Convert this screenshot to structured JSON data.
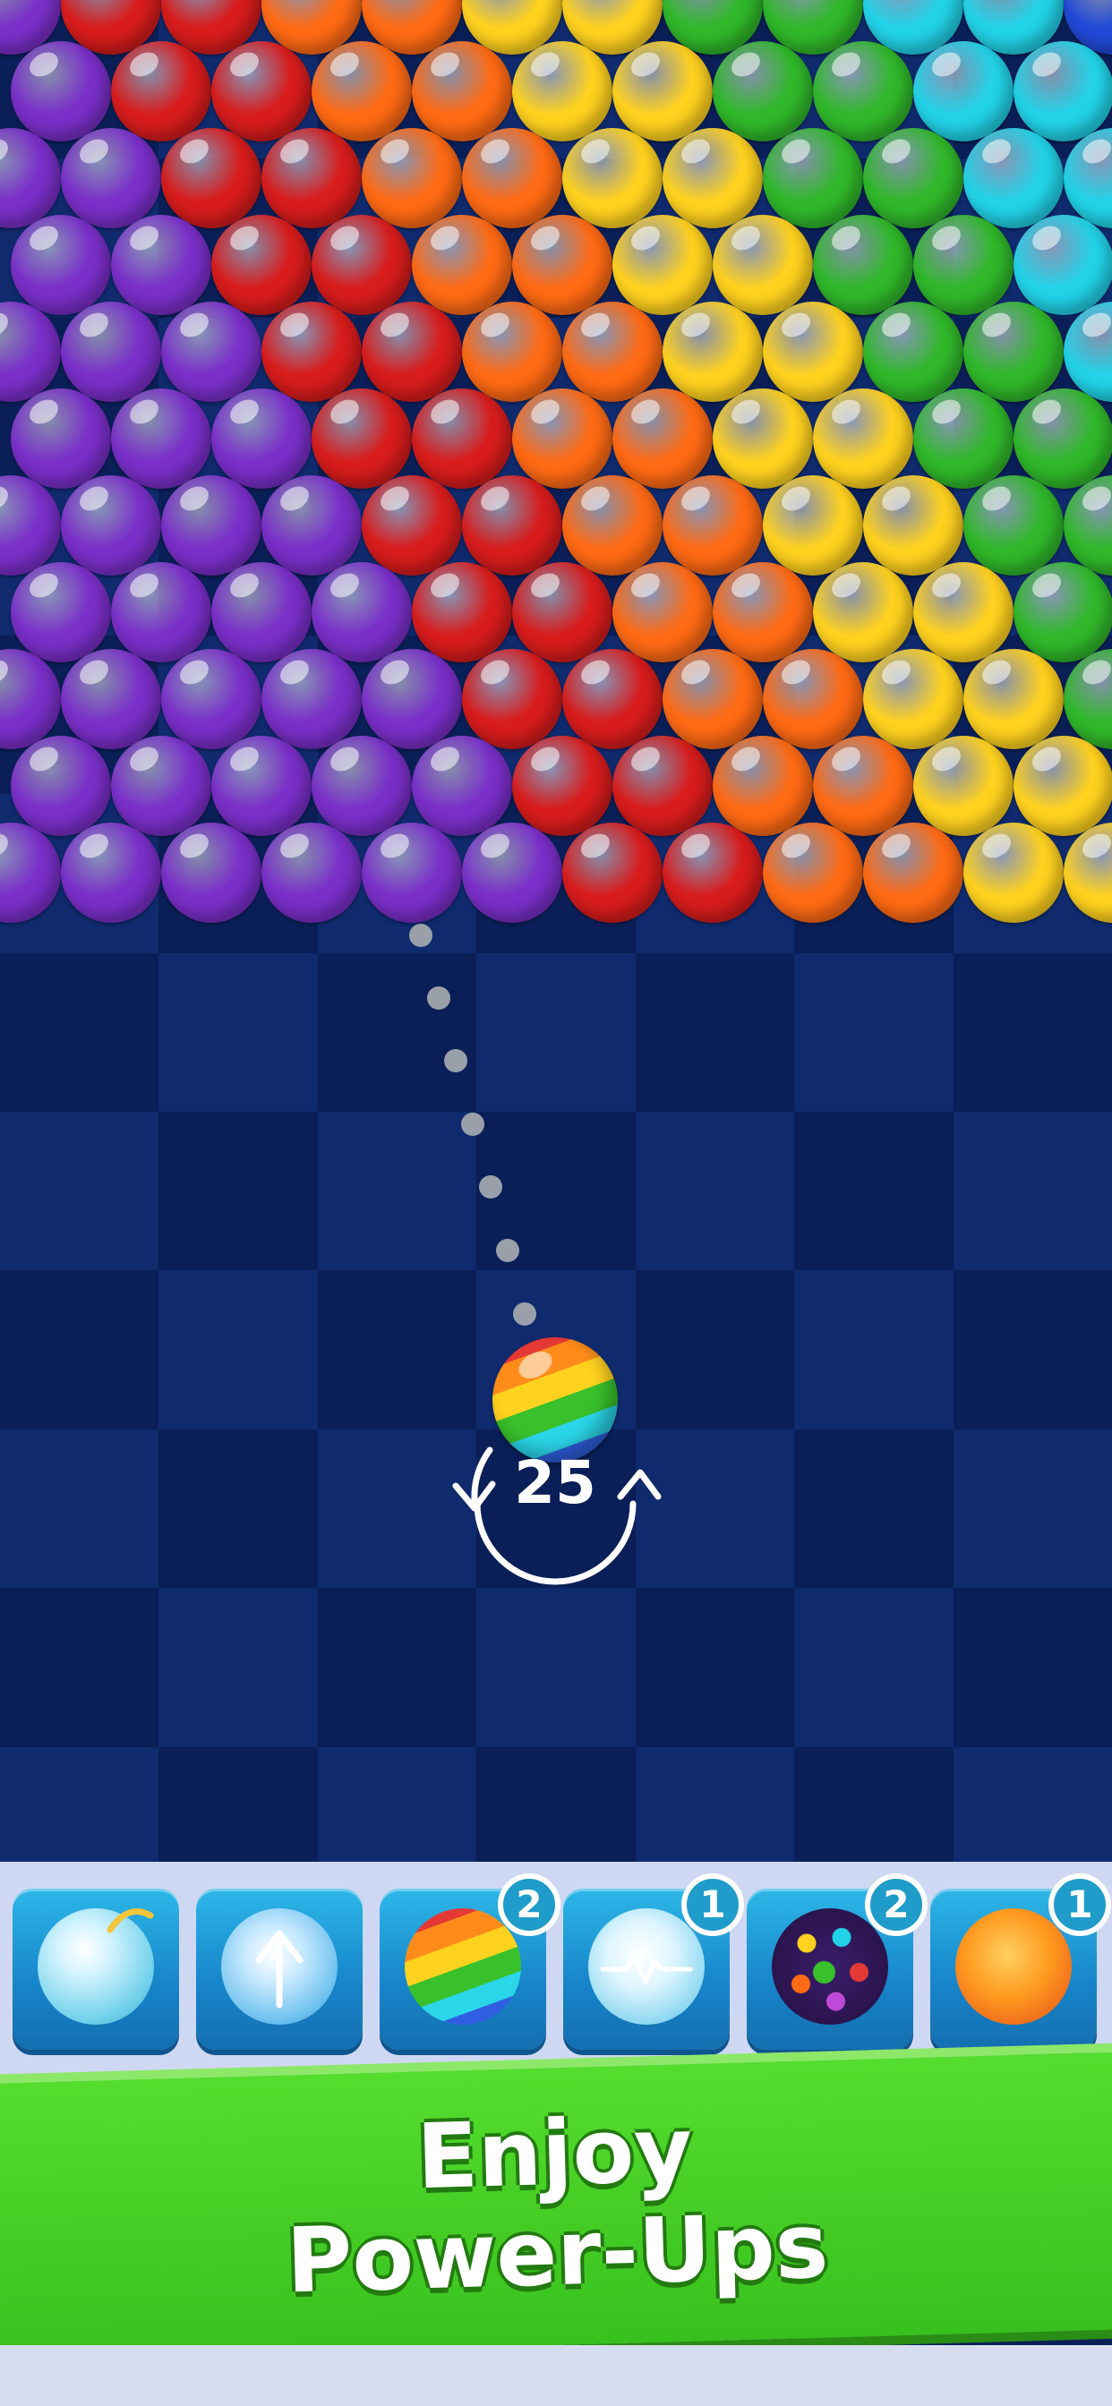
{
  "game": {
    "shots_left": "25",
    "colors": {
      "purple": "#7a2fc9",
      "red": "#d81c1c",
      "orange": "#ff6a14",
      "yellow": "#ffd21f",
      "green": "#30b82a",
      "cyan": "#22d3e8",
      "blue": "#2149d8"
    }
  },
  "powerups": [
    {
      "name": "bomb-bubble",
      "count": ""
    },
    {
      "name": "arrow-bubble",
      "count": ""
    },
    {
      "name": "rainbow-bubble",
      "count": "2"
    },
    {
      "name": "lightning-bubble",
      "count": "1"
    },
    {
      "name": "disco-bubble",
      "count": "2"
    },
    {
      "name": "fireball",
      "count": "1"
    }
  ],
  "banner": {
    "line1": "Enjoy",
    "line2": "Power-Ups"
  }
}
